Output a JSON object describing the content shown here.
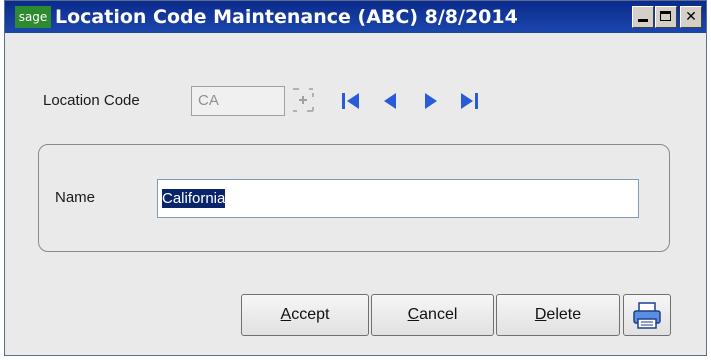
{
  "window": {
    "logo_text": "sage",
    "title": "Location Code Maintenance (ABC) 8/8/2014",
    "controls": {
      "minimize": "minimize",
      "maximize": "maximize",
      "close": "✕"
    }
  },
  "location_code": {
    "label": "Location Code",
    "value": "CA"
  },
  "name_field": {
    "label": "Name",
    "value": "California"
  },
  "buttons": {
    "accept": {
      "mnemonic": "A",
      "rest": "ccept"
    },
    "cancel": {
      "mnemonic": "C",
      "rest": "ancel"
    },
    "delete": {
      "mnemonic": "D",
      "rest": "elete"
    }
  },
  "icons": {
    "lookup": "lookup-icon",
    "first": "first-record-icon",
    "previous": "previous-record-icon",
    "next": "next-record-icon",
    "last": "last-record-icon",
    "print": "printer-icon"
  },
  "colors": {
    "nav_blue": "#2a5bd7",
    "selection": "#0a246a"
  }
}
